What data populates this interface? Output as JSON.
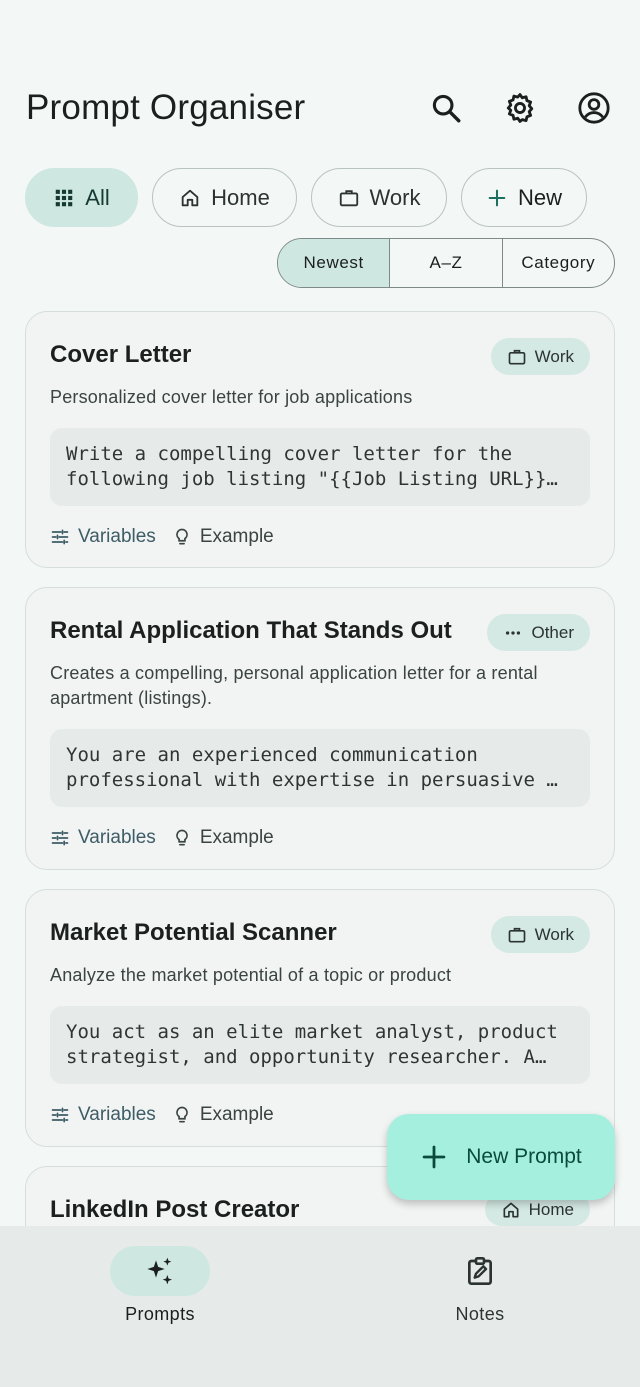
{
  "header": {
    "title": "Prompt Organiser"
  },
  "filters": {
    "chips": [
      {
        "label": "All",
        "icon": "grid-icon"
      },
      {
        "label": "Home",
        "icon": "home-icon"
      },
      {
        "label": "Work",
        "icon": "briefcase-icon"
      },
      {
        "label": "New",
        "icon": "plus-icon"
      }
    ],
    "active": "All"
  },
  "sort": {
    "options": [
      "Newest",
      "A–Z",
      "Category"
    ],
    "active": "Newest"
  },
  "cards": [
    {
      "title": "Cover Letter",
      "category": "Work",
      "description": "Personalized cover letter for job applications",
      "prompt_lines": [
        "Write a compelling cover letter for the",
        "following job listing \"{{Job Listing URL}}…"
      ],
      "variables_label": "Variables",
      "example_label": "Example"
    },
    {
      "title": "Rental Application That Stands Out",
      "category": "Other",
      "description": "Creates a compelling, personal application letter for a rental apartment (listings).",
      "prompt_lines": [
        "You are an experienced communication",
        "professional with expertise in persuasive …"
      ],
      "variables_label": "Variables",
      "example_label": "Example"
    },
    {
      "title": "Market Potential Scanner",
      "category": "Work",
      "description": "Analyze the market potential of a topic or product",
      "prompt_lines": [
        "You act as an elite market analyst, product",
        "strategist, and opportunity researcher.  A…"
      ],
      "variables_label": "Variables",
      "example_label": "Example"
    },
    {
      "title": "LinkedIn Post Creator",
      "category": "Home"
    }
  ],
  "fab": {
    "label": "New Prompt"
  },
  "bottom_nav": {
    "items": [
      {
        "label": "Prompts"
      },
      {
        "label": "Notes"
      }
    ],
    "active": "Prompts"
  },
  "colors": {
    "accent": "#cfe7e1",
    "fab": "#a5efde",
    "background": "#f3f7f5"
  }
}
